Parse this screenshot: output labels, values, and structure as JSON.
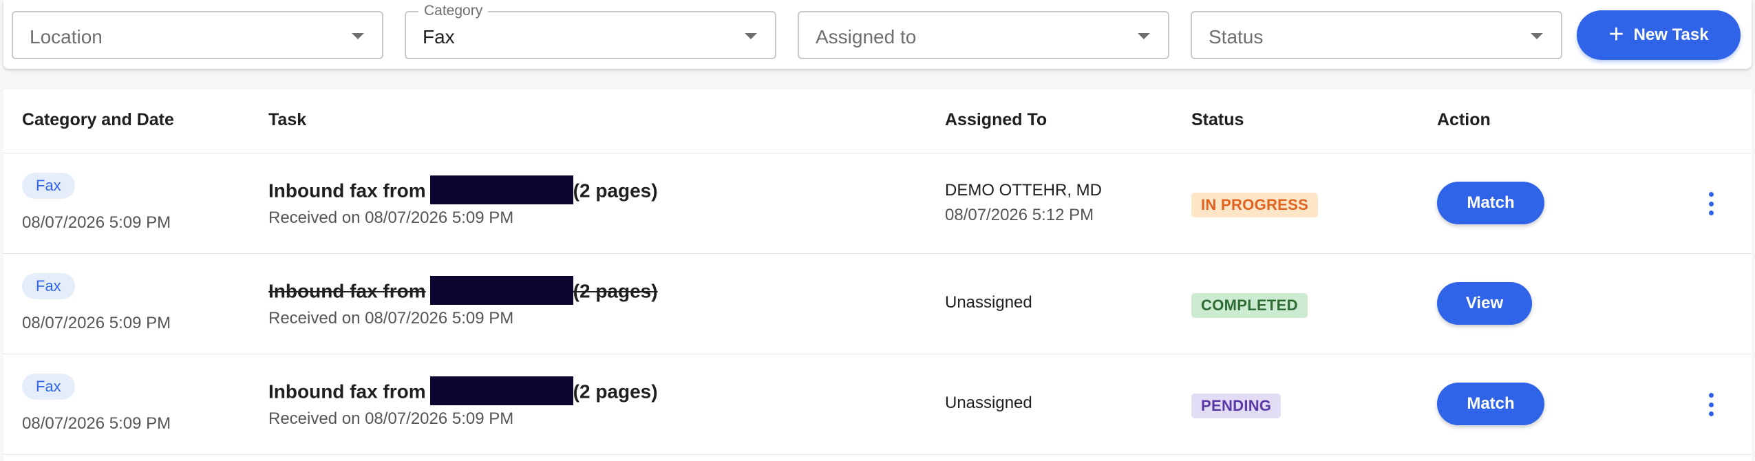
{
  "filters": {
    "location": {
      "value": "Location"
    },
    "category": {
      "label": "Category",
      "value": "Fax"
    },
    "assigned": {
      "value": "Assigned to"
    },
    "status": {
      "value": "Status"
    },
    "new_task_label": "New Task"
  },
  "table": {
    "headers": {
      "category_date": "Category and Date",
      "task": "Task",
      "assigned_to": "Assigned To",
      "status": "Status",
      "action": "Action"
    },
    "rows": [
      {
        "category": "Fax",
        "date": "08/07/2026 5:09 PM",
        "title_prefix": "Inbound fax from",
        "title_suffix": "(2 pages)",
        "received": "Received on 08/07/2026 5:09 PM",
        "assignee": "DEMO OTTEHR, MD",
        "assigned_date": "08/07/2026 5:12 PM",
        "status": "IN PROGRESS",
        "action": "Match"
      },
      {
        "category": "Fax",
        "date": "08/07/2026 5:09 PM",
        "title_prefix": "Inbound fax from",
        "title_suffix": "(2 pages)",
        "received": "Received on 08/07/2026 5:09 PM",
        "assignee": "Unassigned",
        "status": "COMPLETED",
        "action": "View"
      },
      {
        "category": "Fax",
        "date": "08/07/2026 5:09 PM",
        "title_prefix": "Inbound fax from",
        "title_suffix": "(2 pages)",
        "received": "Received on 08/07/2026 5:09 PM",
        "assignee": "Unassigned",
        "status": "PENDING",
        "action": "Match"
      }
    ]
  },
  "colors": {
    "primary": "#2f63e8",
    "status_in_progress_bg": "#fde5c8",
    "status_in_progress_fg": "#e0631f",
    "status_completed_bg": "#cdebd0",
    "status_completed_fg": "#2e6b34",
    "status_pending_bg": "#e2dcf5",
    "status_pending_fg": "#5b3aa6",
    "redaction": "#0d0630"
  },
  "icons": [
    "chevron-down-icon",
    "plus-icon",
    "more-vert-icon"
  ]
}
